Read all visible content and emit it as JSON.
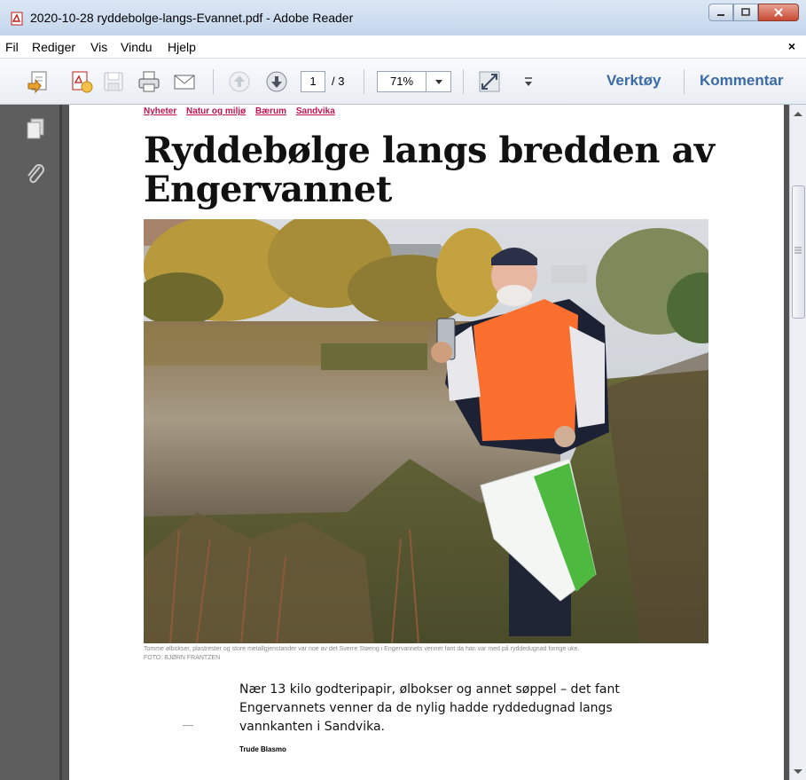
{
  "window": {
    "title": "2020-10-28 ryddebolge-langs-Evannet.pdf - Adobe Reader"
  },
  "menu": {
    "items": [
      "Fil",
      "Rediger",
      "Vis",
      "Vindu",
      "Hjelp"
    ],
    "close_doc": "×"
  },
  "toolbar": {
    "page_current": "1",
    "page_total": "/ 3",
    "zoom": "71%",
    "tools_label": "Verktøy",
    "comment_label": "Kommentar"
  },
  "article": {
    "tags": [
      "Nyheter",
      "Natur og miljø",
      "Bærum",
      "Sandvika"
    ],
    "headline": "Ryddebølge langs bredden av Engervannet",
    "caption_line1": "Tomme ølbokser, plastrester og store metallgjenstander var noe av det Sverre Støeng i Engervannets venner fant da han var med på ryddedugnad forrige uke.",
    "caption_line2": "FOTO: BJØRN FRANTZEN",
    "ingress": "Nær 13 kilo godteripapir, ølbokser og annet søppel – det fant Engervannets venner da de nylig hadde ryddedugnad langs vannkanten i Sandvika.",
    "byline_mark": "___",
    "author": "Trude Blasmo"
  },
  "colors": {
    "tag_color": "#c0134e",
    "link_color": "#3a6aa8",
    "nav_bg": "#5e5e5e"
  }
}
